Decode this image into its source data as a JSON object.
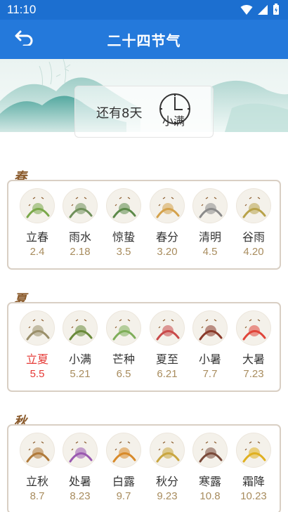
{
  "status_bar": {
    "time": "11:10"
  },
  "app_bar": {
    "title": "二十四节气"
  },
  "countdown": {
    "text": "还有8天",
    "term": "小满"
  },
  "seasons": [
    {
      "label": "春",
      "terms": [
        {
          "name": "立春",
          "date": "2.4",
          "icon": "li-chun-icon",
          "accent": "#7aa84a"
        },
        {
          "name": "雨水",
          "date": "2.18",
          "icon": "yu-shui-icon",
          "accent": "#6f8f5a"
        },
        {
          "name": "惊蛰",
          "date": "3.5",
          "icon": "jing-zhe-icon",
          "accent": "#5d8a4a"
        },
        {
          "name": "春分",
          "date": "3.20",
          "icon": "chun-fen-icon",
          "accent": "#d4a24c"
        },
        {
          "name": "清明",
          "date": "4.5",
          "icon": "qing-ming-icon",
          "accent": "#8a8a8a"
        },
        {
          "name": "谷雨",
          "date": "4.20",
          "icon": "gu-yu-icon",
          "accent": "#b8a24a"
        }
      ]
    },
    {
      "label": "夏",
      "terms": [
        {
          "name": "立夏",
          "date": "5.5",
          "icon": "li-xia-icon",
          "accent": "#9a8f6a",
          "current": true
        },
        {
          "name": "小满",
          "date": "5.21",
          "icon": "xiao-man-icon",
          "accent": "#6a8a3a"
        },
        {
          "name": "芒种",
          "date": "6.5",
          "icon": "mang-zhong-icon",
          "accent": "#7fae5a"
        },
        {
          "name": "夏至",
          "date": "6.21",
          "icon": "xia-zhi-icon",
          "accent": "#c94a4a"
        },
        {
          "name": "小暑",
          "date": "7.7",
          "icon": "xiao-shu-icon",
          "accent": "#8a3a2a"
        },
        {
          "name": "大暑",
          "date": "7.23",
          "icon": "da-shu-icon",
          "accent": "#e0453a"
        }
      ]
    },
    {
      "label": "秋",
      "terms": [
        {
          "name": "立秋",
          "date": "8.7",
          "icon": "li-qiu-icon",
          "accent": "#b07a3a"
        },
        {
          "name": "处暑",
          "date": "8.23",
          "icon": "chu-shu-icon",
          "accent": "#9a5ab0"
        },
        {
          "name": "白露",
          "date": "9.7",
          "icon": "bai-lu-icon",
          "accent": "#d88a2a"
        },
        {
          "name": "秋分",
          "date": "9.23",
          "icon": "qiu-fen-icon",
          "accent": "#c9a640"
        },
        {
          "name": "寒露",
          "date": "10.8",
          "icon": "han-lu-icon",
          "accent": "#7a4a3a"
        },
        {
          "name": "霜降",
          "date": "10.23",
          "icon": "shuang-jiang-icon",
          "accent": "#e0b020"
        }
      ]
    }
  ]
}
